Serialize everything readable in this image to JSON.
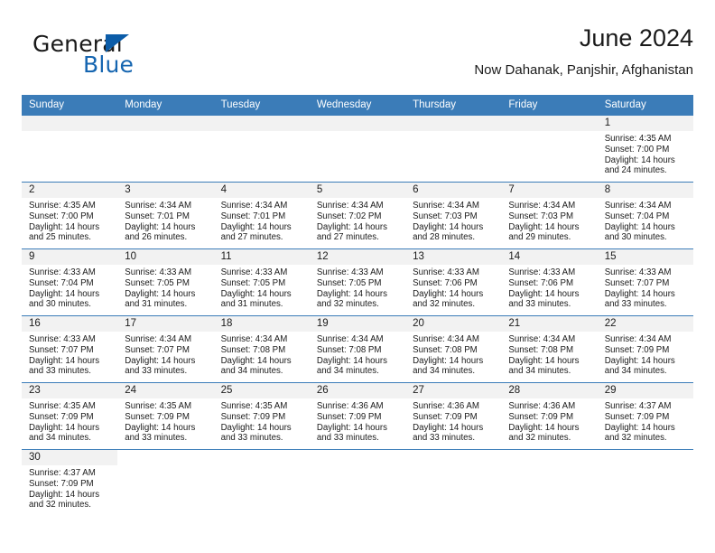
{
  "brand": {
    "word1": "General",
    "word2": "Blue",
    "triangle_color": "#0b5ca8",
    "blue_text_color": "#1565b0"
  },
  "header": {
    "title": "June 2024",
    "subtitle": "Now Dahanak, Panjshir, Afghanistan"
  },
  "theme": {
    "header_blue": "#3b7cb8",
    "daynum_band": "#f2f2f2",
    "text": "#1a1a1a"
  },
  "weekday_headers": [
    "Sunday",
    "Monday",
    "Tuesday",
    "Wednesday",
    "Thursday",
    "Friday",
    "Saturday"
  ],
  "labels": {
    "sunrise_prefix": "Sunrise:",
    "sunset_prefix": "Sunset:",
    "daylight_prefix": "Daylight:"
  },
  "weeks": [
    [
      {
        "day": "",
        "empty": true,
        "line1": "",
        "line2": "",
        "line3": "",
        "line4": ""
      },
      {
        "day": "",
        "empty": true,
        "line1": "",
        "line2": "",
        "line3": "",
        "line4": ""
      },
      {
        "day": "",
        "empty": true,
        "line1": "",
        "line2": "",
        "line3": "",
        "line4": ""
      },
      {
        "day": "",
        "empty": true,
        "line1": "",
        "line2": "",
        "line3": "",
        "line4": ""
      },
      {
        "day": "",
        "empty": true,
        "line1": "",
        "line2": "",
        "line3": "",
        "line4": ""
      },
      {
        "day": "",
        "empty": true,
        "line1": "",
        "line2": "",
        "line3": "",
        "line4": ""
      },
      {
        "day": "1",
        "empty": false,
        "line1": "Sunrise: 4:35 AM",
        "line2": "Sunset: 7:00 PM",
        "line3": "Daylight: 14 hours",
        "line4": "and 24 minutes."
      }
    ],
    [
      {
        "day": "2",
        "empty": false,
        "line1": "Sunrise: 4:35 AM",
        "line2": "Sunset: 7:00 PM",
        "line3": "Daylight: 14 hours",
        "line4": "and 25 minutes."
      },
      {
        "day": "3",
        "empty": false,
        "line1": "Sunrise: 4:34 AM",
        "line2": "Sunset: 7:01 PM",
        "line3": "Daylight: 14 hours",
        "line4": "and 26 minutes."
      },
      {
        "day": "4",
        "empty": false,
        "line1": "Sunrise: 4:34 AM",
        "line2": "Sunset: 7:01 PM",
        "line3": "Daylight: 14 hours",
        "line4": "and 27 minutes."
      },
      {
        "day": "5",
        "empty": false,
        "line1": "Sunrise: 4:34 AM",
        "line2": "Sunset: 7:02 PM",
        "line3": "Daylight: 14 hours",
        "line4": "and 27 minutes."
      },
      {
        "day": "6",
        "empty": false,
        "line1": "Sunrise: 4:34 AM",
        "line2": "Sunset: 7:03 PM",
        "line3": "Daylight: 14 hours",
        "line4": "and 28 minutes."
      },
      {
        "day": "7",
        "empty": false,
        "line1": "Sunrise: 4:34 AM",
        "line2": "Sunset: 7:03 PM",
        "line3": "Daylight: 14 hours",
        "line4": "and 29 minutes."
      },
      {
        "day": "8",
        "empty": false,
        "line1": "Sunrise: 4:34 AM",
        "line2": "Sunset: 7:04 PM",
        "line3": "Daylight: 14 hours",
        "line4": "and 30 minutes."
      }
    ],
    [
      {
        "day": "9",
        "empty": false,
        "line1": "Sunrise: 4:33 AM",
        "line2": "Sunset: 7:04 PM",
        "line3": "Daylight: 14 hours",
        "line4": "and 30 minutes."
      },
      {
        "day": "10",
        "empty": false,
        "line1": "Sunrise: 4:33 AM",
        "line2": "Sunset: 7:05 PM",
        "line3": "Daylight: 14 hours",
        "line4": "and 31 minutes."
      },
      {
        "day": "11",
        "empty": false,
        "line1": "Sunrise: 4:33 AM",
        "line2": "Sunset: 7:05 PM",
        "line3": "Daylight: 14 hours",
        "line4": "and 31 minutes."
      },
      {
        "day": "12",
        "empty": false,
        "line1": "Sunrise: 4:33 AM",
        "line2": "Sunset: 7:05 PM",
        "line3": "Daylight: 14 hours",
        "line4": "and 32 minutes."
      },
      {
        "day": "13",
        "empty": false,
        "line1": "Sunrise: 4:33 AM",
        "line2": "Sunset: 7:06 PM",
        "line3": "Daylight: 14 hours",
        "line4": "and 32 minutes."
      },
      {
        "day": "14",
        "empty": false,
        "line1": "Sunrise: 4:33 AM",
        "line2": "Sunset: 7:06 PM",
        "line3": "Daylight: 14 hours",
        "line4": "and 33 minutes."
      },
      {
        "day": "15",
        "empty": false,
        "line1": "Sunrise: 4:33 AM",
        "line2": "Sunset: 7:07 PM",
        "line3": "Daylight: 14 hours",
        "line4": "and 33 minutes."
      }
    ],
    [
      {
        "day": "16",
        "empty": false,
        "line1": "Sunrise: 4:33 AM",
        "line2": "Sunset: 7:07 PM",
        "line3": "Daylight: 14 hours",
        "line4": "and 33 minutes."
      },
      {
        "day": "17",
        "empty": false,
        "line1": "Sunrise: 4:34 AM",
        "line2": "Sunset: 7:07 PM",
        "line3": "Daylight: 14 hours",
        "line4": "and 33 minutes."
      },
      {
        "day": "18",
        "empty": false,
        "line1": "Sunrise: 4:34 AM",
        "line2": "Sunset: 7:08 PM",
        "line3": "Daylight: 14 hours",
        "line4": "and 34 minutes."
      },
      {
        "day": "19",
        "empty": false,
        "line1": "Sunrise: 4:34 AM",
        "line2": "Sunset: 7:08 PM",
        "line3": "Daylight: 14 hours",
        "line4": "and 34 minutes."
      },
      {
        "day": "20",
        "empty": false,
        "line1": "Sunrise: 4:34 AM",
        "line2": "Sunset: 7:08 PM",
        "line3": "Daylight: 14 hours",
        "line4": "and 34 minutes."
      },
      {
        "day": "21",
        "empty": false,
        "line1": "Sunrise: 4:34 AM",
        "line2": "Sunset: 7:08 PM",
        "line3": "Daylight: 14 hours",
        "line4": "and 34 minutes."
      },
      {
        "day": "22",
        "empty": false,
        "line1": "Sunrise: 4:34 AM",
        "line2": "Sunset: 7:09 PM",
        "line3": "Daylight: 14 hours",
        "line4": "and 34 minutes."
      }
    ],
    [
      {
        "day": "23",
        "empty": false,
        "line1": "Sunrise: 4:35 AM",
        "line2": "Sunset: 7:09 PM",
        "line3": "Daylight: 14 hours",
        "line4": "and 34 minutes."
      },
      {
        "day": "24",
        "empty": false,
        "line1": "Sunrise: 4:35 AM",
        "line2": "Sunset: 7:09 PM",
        "line3": "Daylight: 14 hours",
        "line4": "and 33 minutes."
      },
      {
        "day": "25",
        "empty": false,
        "line1": "Sunrise: 4:35 AM",
        "line2": "Sunset: 7:09 PM",
        "line3": "Daylight: 14 hours",
        "line4": "and 33 minutes."
      },
      {
        "day": "26",
        "empty": false,
        "line1": "Sunrise: 4:36 AM",
        "line2": "Sunset: 7:09 PM",
        "line3": "Daylight: 14 hours",
        "line4": "and 33 minutes."
      },
      {
        "day": "27",
        "empty": false,
        "line1": "Sunrise: 4:36 AM",
        "line2": "Sunset: 7:09 PM",
        "line3": "Daylight: 14 hours",
        "line4": "and 33 minutes."
      },
      {
        "day": "28",
        "empty": false,
        "line1": "Sunrise: 4:36 AM",
        "line2": "Sunset: 7:09 PM",
        "line3": "Daylight: 14 hours",
        "line4": "and 32 minutes."
      },
      {
        "day": "29",
        "empty": false,
        "line1": "Sunrise: 4:37 AM",
        "line2": "Sunset: 7:09 PM",
        "line3": "Daylight: 14 hours",
        "line4": "and 32 minutes."
      }
    ],
    [
      {
        "day": "30",
        "empty": false,
        "line1": "Sunrise: 4:37 AM",
        "line2": "Sunset: 7:09 PM",
        "line3": "Daylight: 14 hours",
        "line4": "and 32 minutes."
      },
      {
        "day": "",
        "empty": true,
        "blank": true,
        "line1": "",
        "line2": "",
        "line3": "",
        "line4": ""
      },
      {
        "day": "",
        "empty": true,
        "blank": true,
        "line1": "",
        "line2": "",
        "line3": "",
        "line4": ""
      },
      {
        "day": "",
        "empty": true,
        "blank": true,
        "line1": "",
        "line2": "",
        "line3": "",
        "line4": ""
      },
      {
        "day": "",
        "empty": true,
        "blank": true,
        "line1": "",
        "line2": "",
        "line3": "",
        "line4": ""
      },
      {
        "day": "",
        "empty": true,
        "blank": true,
        "line1": "",
        "line2": "",
        "line3": "",
        "line4": ""
      },
      {
        "day": "",
        "empty": true,
        "blank": true,
        "line1": "",
        "line2": "",
        "line3": "",
        "line4": ""
      }
    ]
  ]
}
